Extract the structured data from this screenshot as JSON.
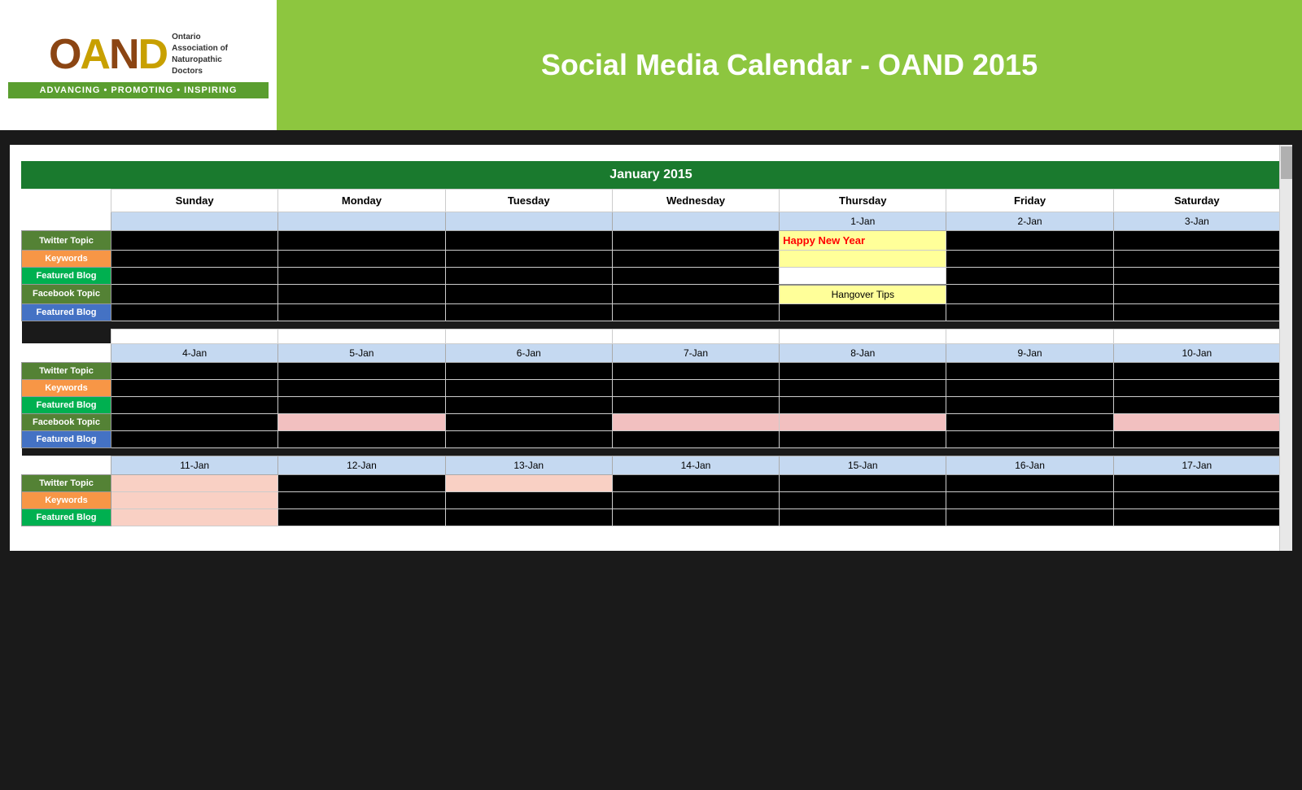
{
  "header": {
    "title": "Social Media Calendar - OAND 2015",
    "logo": {
      "brand": "OAND",
      "subtitle_line1": "Ontario",
      "subtitle_line2": "Association of",
      "subtitle_line3": "Naturopathic",
      "subtitle_line4": "Doctors",
      "tagline": "ADVANCING • PROMOTING • INSPIRING"
    }
  },
  "calendar": {
    "month_label": "January 2015",
    "day_headers": [
      "Sunday",
      "Monday",
      "Tuesday",
      "Wednesday",
      "Thursday",
      "Friday",
      "Saturday"
    ],
    "row_labels": {
      "twitter": "Twitter Topic",
      "keywords": "Keywords",
      "featured": "Featured Blog",
      "facebook": "Facebook Topic",
      "featured_blog": "Featured Blog"
    },
    "week1": {
      "dates": [
        "",
        "",
        "",
        "",
        "1-Jan",
        "2-Jan",
        "3-Jan"
      ],
      "twitter_content": [
        "",
        "",
        "",
        "",
        "Happy New Year",
        "",
        ""
      ],
      "keywords_content": [
        "",
        "",
        "",
        "",
        "",
        "",
        ""
      ],
      "featured_content": [
        "",
        "",
        "",
        "",
        "",
        "",
        ""
      ],
      "facebook_content": [
        "",
        "",
        "",
        "",
        "Hangover Tips",
        "",
        ""
      ],
      "featured_blog_content": [
        "",
        "",
        "",
        "",
        "",
        "",
        ""
      ]
    },
    "week2": {
      "dates": [
        "4-Jan",
        "5-Jan",
        "6-Jan",
        "7-Jan",
        "8-Jan",
        "9-Jan",
        "10-Jan"
      ],
      "twitter_content": [
        "",
        "",
        "",
        "",
        "",
        "",
        ""
      ],
      "keywords_content": [
        "",
        "",
        "",
        "",
        "",
        "",
        ""
      ],
      "featured_content": [
        "",
        "",
        "",
        "",
        "",
        "",
        ""
      ],
      "facebook_content": [
        "",
        "",
        "",
        "",
        "",
        "",
        ""
      ],
      "featured_blog_content": [
        "",
        "",
        "",
        "",
        "",
        "",
        ""
      ]
    },
    "week3": {
      "dates": [
        "11-Jan",
        "12-Jan",
        "13-Jan",
        "14-Jan",
        "15-Jan",
        "16-Jan",
        "17-Jan"
      ],
      "twitter_content": [
        "",
        "",
        "",
        "",
        "",
        "",
        ""
      ],
      "keywords_content": [
        "",
        "",
        "",
        "",
        "",
        "",
        ""
      ],
      "featured_content": [
        "",
        "",
        "",
        "",
        "",
        "",
        ""
      ]
    }
  }
}
